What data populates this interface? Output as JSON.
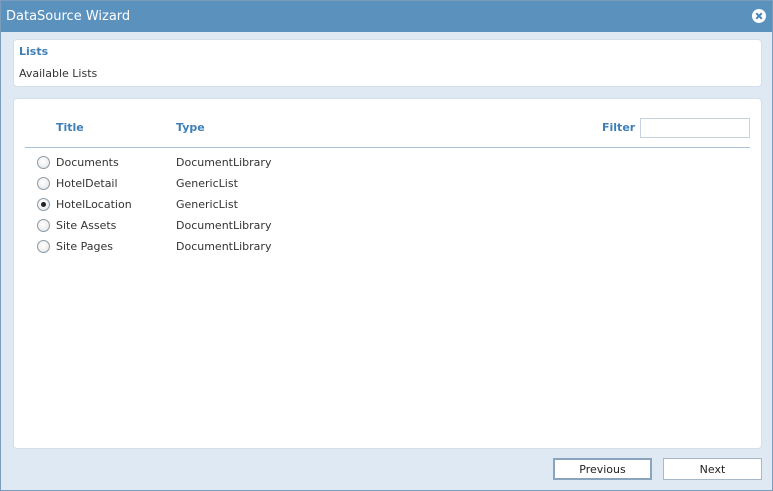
{
  "window": {
    "title": "DataSource Wizard"
  },
  "header": {
    "section_title": "Lists",
    "subtitle": "Available Lists"
  },
  "list": {
    "columns": {
      "title": "Title",
      "type": "Type"
    },
    "filter": {
      "label": "Filter",
      "value": "",
      "placeholder": ""
    },
    "rows": [
      {
        "title": "Documents",
        "type": "DocumentLibrary",
        "selected": false
      },
      {
        "title": "HotelDetail",
        "type": "GenericList",
        "selected": false
      },
      {
        "title": "HotelLocation",
        "type": "GenericList",
        "selected": true
      },
      {
        "title": "Site Assets",
        "type": "DocumentLibrary",
        "selected": false
      },
      {
        "title": "Site Pages",
        "type": "DocumentLibrary",
        "selected": false
      }
    ]
  },
  "footer": {
    "previous_label": "Previous",
    "next_label": "Next"
  }
}
